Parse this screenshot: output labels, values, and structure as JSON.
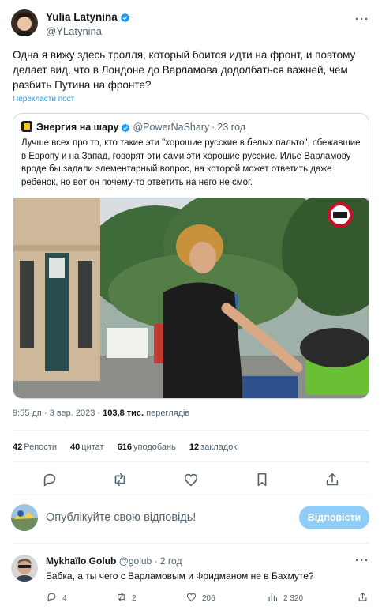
{
  "tweet": {
    "author_name": "Yulia Latynina",
    "author_handle": "@YLatynina",
    "more": "···",
    "text": "Одна я вижу здесь тролля, который боится идти на фронт, и поэтому делает вид, что в Лондоне до Варламова додолбаться важней, чем разбить Путина на фронте?",
    "translate_link": "Перекласти пост"
  },
  "quote": {
    "author_name": "Энергия на шару",
    "author_handle": "@PowerNaShary",
    "dot": "·",
    "time": "23 год",
    "text": "Лучше всех про то, кто такие эти \"хорошие русские в белых пальто\", сбежавшие в Европу и на Запад, говорят эти сами эти хорошие русские. Илье Варламову вроде бы задали элементарный вопрос, на которой может ответить даже ребенок, но вот он почему-то ответить на него не смог."
  },
  "meta": {
    "time": "9:55 дп",
    "dot1": "·",
    "date": "3 вер. 2023",
    "dot2": "·",
    "views_count": "103,8 тис.",
    "views_label": "переглядів"
  },
  "stats": {
    "reposts_count": "42",
    "reposts_label": "Репости",
    "quotes_count": "40",
    "quotes_label": "цитат",
    "likes_count": "616",
    "likes_label": "уподобань",
    "bookmarks_count": "12",
    "bookmarks_label": "закладок"
  },
  "reply": {
    "placeholder": "Опублікуйте свою відповідь!",
    "button": "Відповісти"
  },
  "comment": {
    "author_name": "Mykhaïlo Golub",
    "author_handle": "@golub",
    "dot": "·",
    "time": "2 год",
    "text": "Бабка, а ты чего с Варламовым и Фридманом не в Бахмуте?",
    "replies": "4",
    "reposts": "2",
    "likes": "206",
    "views": "2 320",
    "more": "···"
  },
  "colors": {
    "accent": "#1d9bf0",
    "reply_button": "#8ecdf7",
    "secondary_text": "#536471",
    "border": "#cfd9de"
  },
  "icons": [
    "verified-badge-icon",
    "more-icon",
    "reply-icon",
    "repost-icon",
    "like-icon",
    "bookmark-icon",
    "share-icon",
    "views-icon"
  ]
}
